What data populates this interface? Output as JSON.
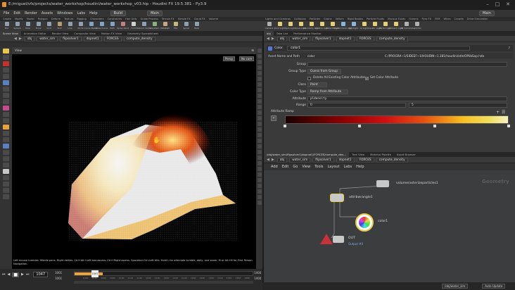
{
  "window": {
    "title": "E:/miguel/vfx/projects/water_workshop/houdini/water_workshop_v03.hip - Houdini FX 19.5.381 - Py3.9",
    "controls": [
      "minimize-icon",
      "maximize-icon",
      "close-icon"
    ]
  },
  "menubar": {
    "items": [
      "File",
      "Edit",
      "Render",
      "Assets",
      "Windows",
      "Labs",
      "Help"
    ],
    "desktop_left": "Build",
    "desktop_center": "Main",
    "desktop_right": "Main"
  },
  "shelf_left": {
    "tabs": [
      "Create",
      "Modify",
      "Model",
      "Polygon",
      "Deform",
      "Texture",
      "Rigging",
      "Characters",
      "Constraints",
      "Hair Utils",
      "Guide Process",
      "Terrain FX",
      "Simple FX",
      "Cloud FX",
      "Volume"
    ],
    "tools": [
      {
        "label": "Box",
        "color": "#8ea0b4"
      },
      {
        "label": "Sphere",
        "color": "#8ea0b4"
      },
      {
        "label": "Tube",
        "color": "#8ea0b4"
      },
      {
        "label": "Torus",
        "color": "#8ea0b4"
      },
      {
        "label": "Grid",
        "color": "#8ea0b4"
      },
      {
        "label": "Null",
        "color": "#b4a06e"
      },
      {
        "label": "Line",
        "color": "#8ea0b4"
      },
      {
        "label": "Circle",
        "color": "#8ea0b4"
      },
      {
        "label": "Curve Bezier",
        "color": "#7ea4c8"
      },
      {
        "label": "Draw Curve",
        "color": "#7ea4c8"
      },
      {
        "label": "Path",
        "color": "#7ea4c8"
      },
      {
        "label": "Spray Paint",
        "color": "#c87e7e"
      },
      {
        "label": "Font",
        "color": "#d0d0d0"
      },
      {
        "label": "Platonic Solids",
        "color": "#8ea0b4"
      },
      {
        "label": "L-System",
        "color": "#88b478"
      },
      {
        "label": "Metaball",
        "color": "#c8a878"
      },
      {
        "label": "File",
        "color": "#c8b878"
      },
      {
        "label": "Spiral",
        "color": "#8ea0b4"
      },
      {
        "label": "Helix",
        "color": "#8ea0b4"
      }
    ]
  },
  "shelf_right": {
    "tabs": [
      "Lights and Cameras",
      "Collisions",
      "Particles",
      "Grains",
      "Vellum",
      "Rigid Bodies",
      "Particle Fluids",
      "Viscous Fluids",
      "Oceans",
      "Pyro FX",
      "FEM",
      "Wires",
      "Crowds",
      "Drive Simulation"
    ],
    "tools": [
      {
        "label": "Camera",
        "color": "#b0b0b0"
      },
      {
        "label": "Point Light",
        "color": "#e8d070"
      },
      {
        "label": "Spot Light",
        "color": "#e8d070"
      },
      {
        "label": "Area Light",
        "color": "#e8d070"
      },
      {
        "label": "Geometry Light",
        "color": "#e8d070"
      },
      {
        "label": "Volume Light",
        "color": "#e8d070"
      },
      {
        "label": "Distant Light",
        "color": "#e8d070"
      },
      {
        "label": "Environment Light",
        "color": "#8ab4e0"
      },
      {
        "label": "Sky Light",
        "color": "#8ab4e0"
      },
      {
        "label": "GI Light",
        "color": "#e8d070"
      },
      {
        "label": "Caustic Light",
        "color": "#e8d070"
      },
      {
        "label": "Portal Light",
        "color": "#e8d070"
      },
      {
        "label": "Ambient Light",
        "color": "#e8d070"
      },
      {
        "label": "VR Camera",
        "color": "#b0b0b0"
      },
      {
        "label": "Switcher",
        "color": "#b0b0b0"
      }
    ]
  },
  "left_pane": {
    "tabs": [
      "Scene View",
      "Animation Editor",
      "Render View",
      "Composite View",
      "Motion FX View",
      "Geometry Spreadsheet"
    ],
    "path": [
      "obj",
      "water_sim"
    ],
    "path_tabs": [
      "flipsolver1",
      "dopnet1",
      "FORCES",
      "compute_density"
    ],
    "view_label": "View",
    "persp_label": "Persp",
    "cam_label": "No cam",
    "hint_text": "Left mouse tumbles. Middle pans. Right dollies. Ctrl+Alt+Left box-zooms. Ctrl+Right zooms. Spacebar-Ctrl-Left tilts. Hold L for alternate tumble, dolly, and zoom.     M or Alt+M for First Person Navigation."
  },
  "timeline": {
    "current_frame": "1047",
    "start_frame": "1001",
    "start_frame2": "1001",
    "end_frame": "1400",
    "end_frame2": "1400",
    "playhead_label": "1047",
    "ticks": [
      "1020",
      "1040",
      "1060",
      "1080",
      "1100",
      "1120",
      "1140",
      "1160",
      "1180",
      "1200",
      "1220",
      "1240",
      "1260",
      "1280",
      "1300",
      "1320",
      "1340",
      "1360",
      "1380"
    ],
    "cache_fraction": 0.16
  },
  "param_pane": {
    "tabs": [
      "obj",
      "Take List",
      "Performance Monitor"
    ],
    "path": [
      "obj",
      "water_sim"
    ],
    "path_tabs": [
      "flipsolver1",
      "dopnet1",
      "FORCES",
      "compute_density"
    ],
    "node_type": "Color",
    "node_name": "color1",
    "asset_label": "Asset Name and Path",
    "asset_value": "color",
    "asset_path": "C:/PROGRA~1/SIDEEF~1/HOUDIN~1.381/houdini/otls/OPlibSop.hda",
    "params": [
      {
        "label": "Group",
        "value": ""
      },
      {
        "label": "Group Type",
        "value": "Guess from Group"
      },
      {
        "label": "Class",
        "value": "Point"
      },
      {
        "label": "Color Type",
        "value": "Ramp from Attribute"
      },
      {
        "label": "Attribute",
        "value": "pldensity"
      },
      {
        "label": "Range",
        "value": "0",
        "value2": "5"
      }
    ],
    "check_delete": "Delete All Existing Color Attributes",
    "check_setcolor": "Set Color Attribute",
    "ramp_label": "Attribute Ramp"
  },
  "network_pane": {
    "tabs": [
      "/obj/water_sim/flipsolver1/dopnet1/FORCES/compute_den...",
      "Tree View",
      "Material Palette",
      "Asset Browser"
    ],
    "path": [
      "obj",
      "water_sim"
    ],
    "path_tabs": [
      "flipsolver1",
      "dopnet1",
      "FORCES",
      "compute_density"
    ],
    "menu": [
      "Add",
      "Edit",
      "Go",
      "View",
      "Tools",
      "Layout",
      "Labs",
      "Help"
    ],
    "context_label": "Geometry",
    "nodes": [
      {
        "name": "volumerasterizeparticles1",
        "sub": ""
      },
      {
        "name": "attribwrangle1",
        "sub": ""
      },
      {
        "name": "color1",
        "sub": ""
      },
      {
        "name": "OUT",
        "sub": "Output #0"
      }
    ]
  },
  "statusbar": {
    "path": "/obj/water_sim",
    "auto_update": "Auto Update"
  },
  "colors": {
    "accent": "#f0a23a",
    "selected_node": "#e8c84a",
    "out_node": "#c8303a",
    "color_node": "#5878d8"
  }
}
